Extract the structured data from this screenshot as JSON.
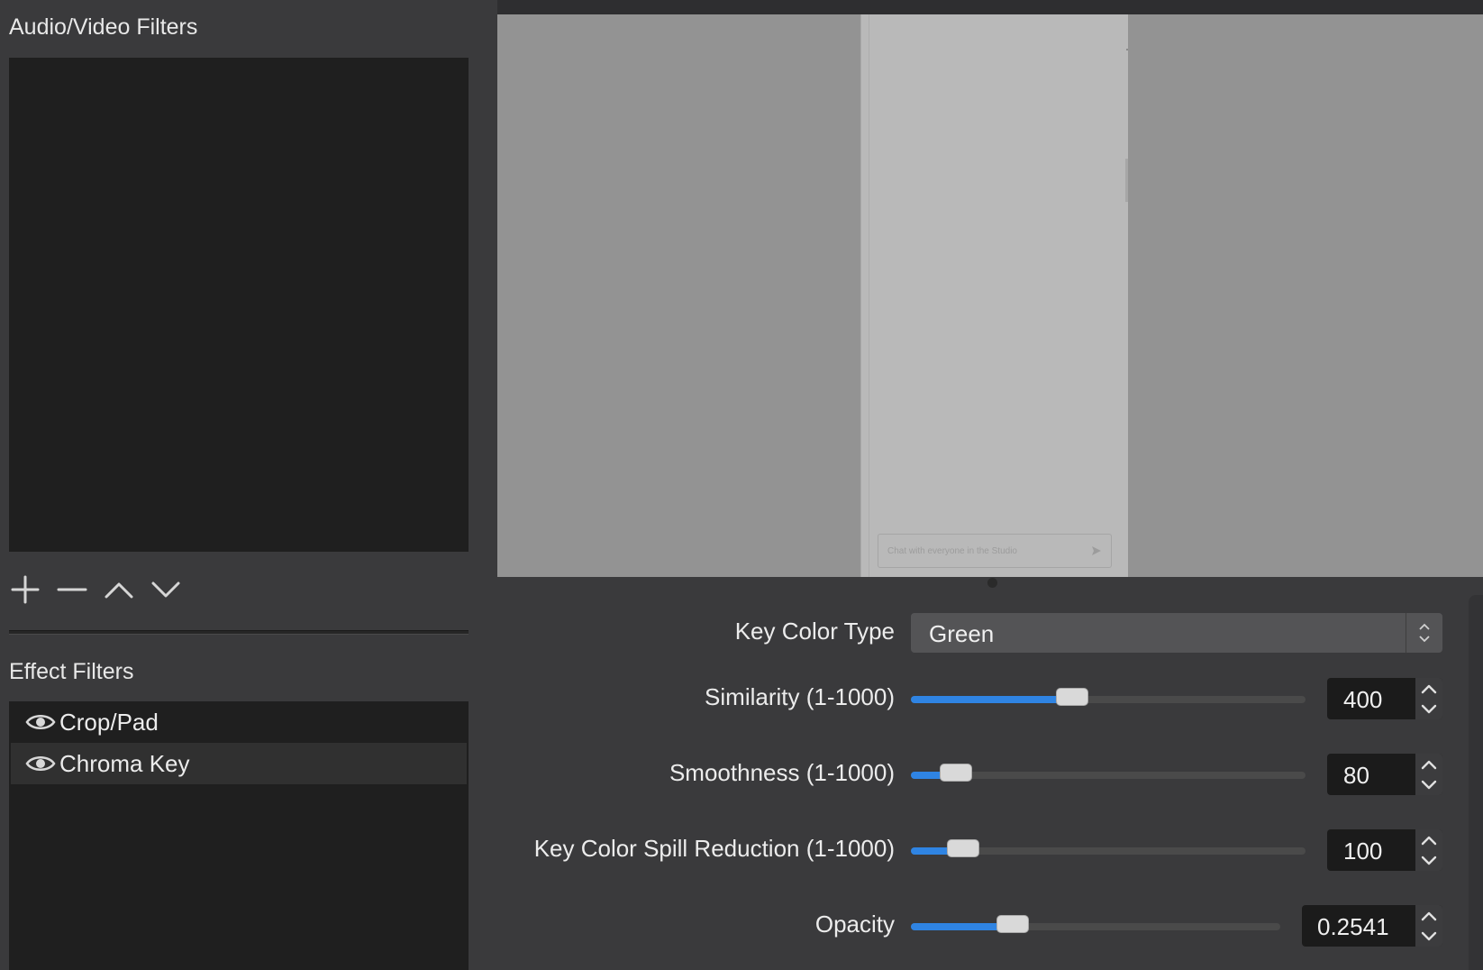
{
  "audio_video": {
    "title": "Audio/Video Filters"
  },
  "toolbar": {
    "add_icon": "plus-icon",
    "remove_icon": "minus-icon",
    "up_icon": "chevron-up-icon",
    "down_icon": "chevron-down-icon"
  },
  "effects": {
    "title": "Effect Filters",
    "items": [
      {
        "label": "Crop/Pad",
        "icon": "eye-icon",
        "selected": false
      },
      {
        "label": "Chroma Key",
        "icon": "eye-icon",
        "selected": true
      }
    ]
  },
  "preview": {
    "chat_placeholder": "Chat with everyone in the Studio"
  },
  "properties": {
    "key_color_type": {
      "label": "Key Color Type",
      "value": "Green"
    },
    "similarity": {
      "label": "Similarity (1-1000)",
      "value": "400",
      "fraction": 0.4
    },
    "smoothness": {
      "label": "Smoothness (1-1000)",
      "value": "80",
      "fraction": 0.08
    },
    "spill": {
      "label": "Key Color Spill Reduction (1-1000)",
      "value": "100",
      "fraction": 0.1
    },
    "opacity": {
      "label": "Opacity",
      "value": "0.2541",
      "fraction": 0.2541
    }
  },
  "colors": {
    "accent": "#2f84e3",
    "background": "#3a3a3c",
    "list_bg": "#1f1f1f"
  }
}
